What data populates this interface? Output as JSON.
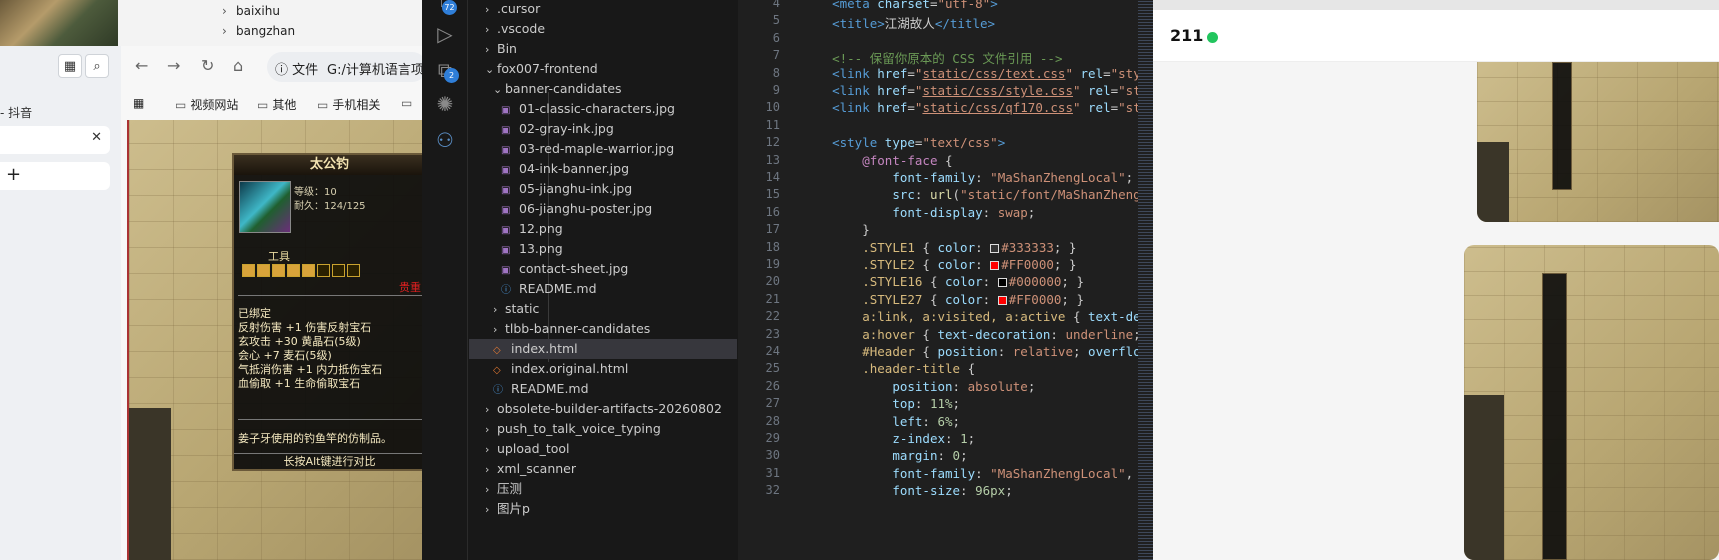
{
  "tree_strip": {
    "items": [
      "baixihu",
      "bangzhan"
    ]
  },
  "browser": {
    "side_tab_label": "- 抖音",
    "url_info_label": "文件",
    "url_text": "G:/计算机语言项",
    "bookmarks": [
      "视频网站",
      "其他",
      "手机相关"
    ],
    "close_glyph": "✕",
    "add_glyph": "+"
  },
  "game_tooltip": {
    "title": "太公钓",
    "level": "等级：10",
    "durability": "耐久：124/125",
    "tools_label": "工具",
    "red_label": "贵重",
    "properties": [
      "已绑定",
      "反射伤害 +1 伤害反射宝石",
      "玄攻击 +30 黄晶石(5级)",
      "会心 +7 麦石(5级)",
      "气抵消伤害 +1 内力抵伤宝石",
      "血偷取 +1 生命偷取宝石"
    ],
    "description": "姜子牙使用的钓鱼竿的仿制品。",
    "footer": "长按Alt键进行对比"
  },
  "vscode": {
    "badges": {
      "source_control": "72",
      "extensions": "2"
    },
    "explorer": [
      {
        "label": ".cursor",
        "kind": "folder",
        "indent": 0,
        "chev": "›"
      },
      {
        "label": ".vscode",
        "kind": "folder",
        "indent": 0,
        "chev": "›"
      },
      {
        "label": "Bin",
        "kind": "folder",
        "indent": 0,
        "chev": "›"
      },
      {
        "label": "fox007-frontend",
        "kind": "folder",
        "indent": 0,
        "chev": "⌄"
      },
      {
        "label": "banner-candidates",
        "kind": "folder",
        "indent": 1,
        "chev": "⌄"
      },
      {
        "label": "01-classic-characters.jpg",
        "kind": "img",
        "indent": 2
      },
      {
        "label": "02-gray-ink.jpg",
        "kind": "img",
        "indent": 2
      },
      {
        "label": "03-red-maple-warrior.jpg",
        "kind": "img",
        "indent": 2
      },
      {
        "label": "04-ink-banner.jpg",
        "kind": "img",
        "indent": 2
      },
      {
        "label": "05-jianghu-ink.jpg",
        "kind": "img",
        "indent": 2
      },
      {
        "label": "06-jianghu-poster.jpg",
        "kind": "img",
        "indent": 2
      },
      {
        "label": "12.png",
        "kind": "img",
        "indent": 2
      },
      {
        "label": "13.png",
        "kind": "img",
        "indent": 2
      },
      {
        "label": "contact-sheet.jpg",
        "kind": "img",
        "indent": 2
      },
      {
        "label": "README.md",
        "kind": "info",
        "indent": 2
      },
      {
        "label": "static",
        "kind": "folder",
        "indent": 1,
        "chev": "›"
      },
      {
        "label": "tlbb-banner-candidates",
        "kind": "folder",
        "indent": 1,
        "chev": "›"
      },
      {
        "label": "index.html",
        "kind": "html",
        "indent": 1,
        "selected": true
      },
      {
        "label": "index.original.html",
        "kind": "html",
        "indent": 1
      },
      {
        "label": "README.md",
        "kind": "info",
        "indent": 1
      },
      {
        "label": "obsolete-builder-artifacts-20260802",
        "kind": "folder",
        "indent": 0,
        "chev": "›"
      },
      {
        "label": "push_to_talk_voice_typing",
        "kind": "folder",
        "indent": 0,
        "chev": "›"
      },
      {
        "label": "upload_tool",
        "kind": "folder",
        "indent": 0,
        "chev": "›"
      },
      {
        "label": "xml_scanner",
        "kind": "folder",
        "indent": 0,
        "chev": "›"
      },
      {
        "label": "压测",
        "kind": "folder",
        "indent": 0,
        "chev": "›"
      },
      {
        "label": "图片p",
        "kind": "folder",
        "indent": 0,
        "chev": "›"
      }
    ],
    "code_lines": [
      {
        "n": "4",
        "html": "    <span class='t-tag'>&lt;meta</span> <span class='t-attr'>charset</span>=<span class='t-str'>\"utf-8\"</span><span class='t-tag'>&gt;</span>"
      },
      {
        "n": "5",
        "html": "    <span class='t-tag'>&lt;title&gt;</span>江湖故人<span class='t-tag'>&lt;/title&gt;</span>"
      },
      {
        "n": "6",
        "html": ""
      },
      {
        "n": "7",
        "html": "    <span class='t-com'>&lt;!-- 保留你原本的 CSS 文件引用 --&gt;</span>"
      },
      {
        "n": "8",
        "html": "    <span class='t-tag'>&lt;link</span> <span class='t-attr'>href</span>=<span class='t-str'>\"<u>static/css/text.css</u>\"</span> <span class='t-attr'>rel</span>=<span class='t-str'>\"sty</span>"
      },
      {
        "n": "9",
        "html": "    <span class='t-tag'>&lt;link</span> <span class='t-attr'>href</span>=<span class='t-str'>\"<u>static/css/style.css</u>\"</span> <span class='t-attr'>rel</span>=<span class='t-str'>\"st</span>"
      },
      {
        "n": "10",
        "html": "    <span class='t-tag'>&lt;link</span> <span class='t-attr'>href</span>=<span class='t-str'>\"<u>static/css/qf170.css</u>\"</span> <span class='t-attr'>rel</span>=<span class='t-str'>\"st</span>"
      },
      {
        "n": "11",
        "html": ""
      },
      {
        "n": "12",
        "html": "    <span class='t-tag'>&lt;style</span> <span class='t-attr'>type</span>=<span class='t-str'>\"text/css\"</span><span class='t-tag'>&gt;</span>"
      },
      {
        "n": "13",
        "html": "        <span class='t-at'>@font-face</span> {"
      },
      {
        "n": "14",
        "html": "            <span class='t-prop'>font-family</span>: <span class='t-val'>\"MaShanZhengLocal\"</span>;"
      },
      {
        "n": "15",
        "html": "            <span class='t-prop'>src</span>: <span class='t-fn'>url</span>(<span class='t-val'>\"static/font/MaShanZheng</span>"
      },
      {
        "n": "16",
        "html": "            <span class='t-prop'>font-display</span>: <span class='t-val'>swap</span>;"
      },
      {
        "n": "17",
        "html": "        }"
      },
      {
        "n": "18",
        "html": "        <span class='t-sel'>.STYLE1</span> { <span class='t-prop'>color</span>: <span class='swatch' style='background:#333333'></span><span class='t-val'>#333333</span>; }"
      },
      {
        "n": "19",
        "html": "        <span class='t-sel'>.STYLE2</span> { <span class='t-prop'>color</span>: <span class='swatch' style='background:#FF0000'></span><span class='t-val'>#FF0000</span>; }"
      },
      {
        "n": "20",
        "html": "        <span class='t-sel'>.STYLE16</span> { <span class='t-prop'>color</span>: <span class='swatch' style='background:#000000'></span><span class='t-val'>#000000</span>; }"
      },
      {
        "n": "21",
        "html": "        <span class='t-sel'>.STYLE27</span> { <span class='t-prop'>color</span>: <span class='swatch' style='background:#FF0000'></span><span class='t-val'>#FF0000</span>; }"
      },
      {
        "n": "22",
        "html": "        <span class='t-sel'>a:link, a:visited, a:active</span> { <span class='t-prop'>text-de</span>"
      },
      {
        "n": "23",
        "html": "        <span class='t-sel'>a:hover</span> { <span class='t-prop'>text-decoration</span>: <span class='t-val'>underline</span>; }"
      },
      {
        "n": "24",
        "html": "        <span class='t-sel'>#Header</span> { <span class='t-prop'>position</span>: <span class='t-val'>relative</span>; <span class='t-prop'>overflow</span>"
      },
      {
        "n": "25",
        "html": "        <span class='t-sel'>.header-title</span> {"
      },
      {
        "n": "26",
        "html": "            <span class='t-prop'>position</span>: <span class='t-val'>absolute</span>;"
      },
      {
        "n": "27",
        "html": "            <span class='t-prop'>top</span>: <span class='t-num'>11%</span>;"
      },
      {
        "n": "28",
        "html": "            <span class='t-prop'>left</span>: <span class='t-num'>6%</span>;"
      },
      {
        "n": "29",
        "html": "            <span class='t-prop'>z-index</span>: <span class='t-num'>1</span>;"
      },
      {
        "n": "30",
        "html": "            <span class='t-prop'>margin</span>: <span class='t-num'>0</span>;"
      },
      {
        "n": "31",
        "html": "            <span class='t-prop'>font-family</span>: <span class='t-val'>\"MaShanZhengLocal\"</span>, <span class='t-val'>\"S</span>"
      },
      {
        "n": "32",
        "html": "            <span class='t-prop'>font-size</span>: <span class='t-num'>96px</span>;"
      }
    ]
  },
  "right_app": {
    "count": "211",
    "status_color": "#22c55e"
  }
}
